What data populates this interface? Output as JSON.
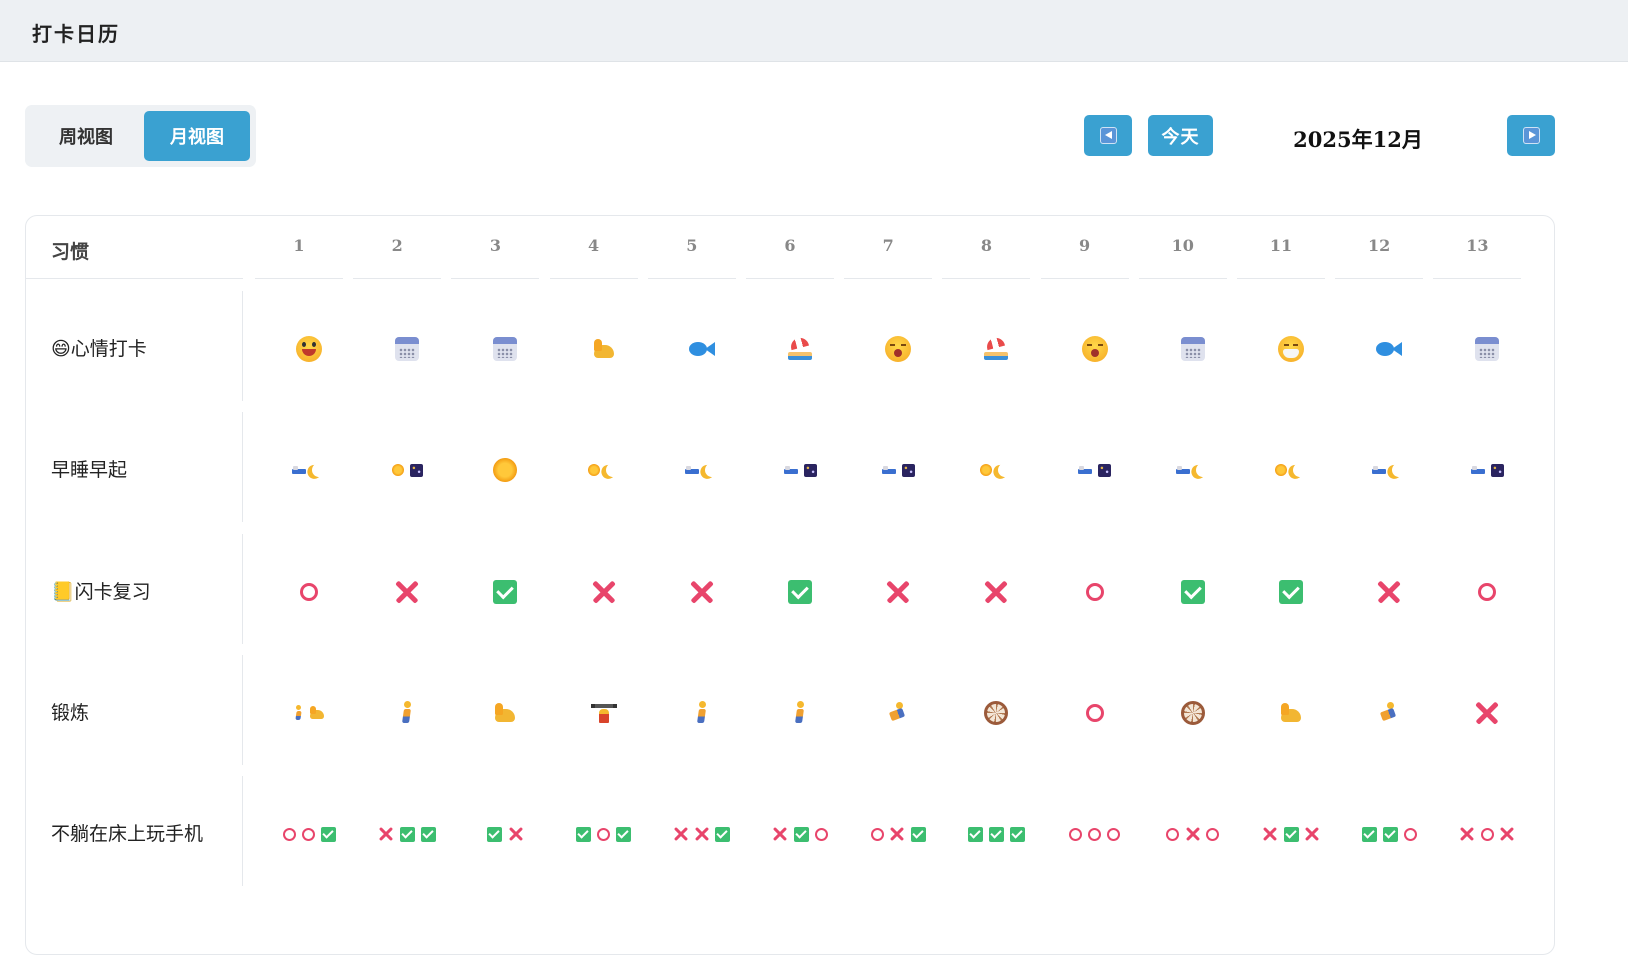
{
  "app": {
    "title": "打卡日历"
  },
  "toolbar": {
    "views": [
      {
        "label": "周视图",
        "active": false
      },
      {
        "label": "月视图",
        "active": true
      }
    ],
    "today_label": "今天",
    "month_label": "2025年12月",
    "accent_color": "#3aa1d1"
  },
  "table": {
    "habit_header": "习惯",
    "days": [
      "1",
      "2",
      "3",
      "4",
      "5",
      "6",
      "7",
      "8",
      "9",
      "10",
      "11",
      "12",
      "13"
    ],
    "rows": [
      {
        "label": "😄心情打卡",
        "cells": [
          [
            "grin"
          ],
          [
            "calendar"
          ],
          [
            "calendar"
          ],
          [
            "muscle"
          ],
          [
            "fish"
          ],
          [
            "beach"
          ],
          [
            "yawn"
          ],
          [
            "beach"
          ],
          [
            "yawn"
          ],
          [
            "calendar"
          ],
          [
            "mask"
          ],
          [
            "fish"
          ],
          [
            "calendar"
          ]
        ]
      },
      {
        "label": "早睡早起",
        "cells": [
          [
            "bed",
            "moon"
          ],
          [
            "sun",
            "night"
          ],
          [
            "sun-large"
          ],
          [
            "sun",
            "moon"
          ],
          [
            "bed",
            "moon"
          ],
          [
            "bed",
            "night"
          ],
          [
            "bed",
            "night"
          ],
          [
            "sun",
            "moon"
          ],
          [
            "bed",
            "night"
          ],
          [
            "bed",
            "moon"
          ],
          [
            "sun",
            "moon"
          ],
          [
            "bed",
            "moon"
          ],
          [
            "bed",
            "night"
          ]
        ]
      },
      {
        "label": "📒闪卡复习",
        "cells": [
          [
            "circle"
          ],
          [
            "cross"
          ],
          [
            "check"
          ],
          [
            "cross"
          ],
          [
            "cross"
          ],
          [
            "check"
          ],
          [
            "cross"
          ],
          [
            "cross"
          ],
          [
            "circle"
          ],
          [
            "check"
          ],
          [
            "check"
          ],
          [
            "cross"
          ],
          [
            "circle"
          ]
        ]
      },
      {
        "label": "锻炼",
        "cells": [
          [
            "walk-small",
            "muscle-small"
          ],
          [
            "walk"
          ],
          [
            "muscle"
          ],
          [
            "lift"
          ],
          [
            "walk"
          ],
          [
            "walk"
          ],
          [
            "run"
          ],
          [
            "wheel"
          ],
          [
            "circle"
          ],
          [
            "wheel"
          ],
          [
            "muscle"
          ],
          [
            "run"
          ],
          [
            "cross"
          ]
        ]
      },
      {
        "label": "不躺在床上玩手机",
        "cells": [
          [
            "circle",
            "circle",
            "check"
          ],
          [
            "cross",
            "check",
            "check"
          ],
          [
            "check",
            "cross"
          ],
          [
            "check",
            "circle",
            "check"
          ],
          [
            "cross",
            "cross",
            "check"
          ],
          [
            "cross",
            "check",
            "circle"
          ],
          [
            "circle",
            "cross",
            "check"
          ],
          [
            "check",
            "check",
            "check"
          ],
          [
            "circle",
            "circle",
            "circle"
          ],
          [
            "circle",
            "cross",
            "circle"
          ],
          [
            "cross",
            "check",
            "cross"
          ],
          [
            "check",
            "check",
            "circle"
          ],
          [
            "cross",
            "circle",
            "cross"
          ]
        ]
      }
    ]
  }
}
